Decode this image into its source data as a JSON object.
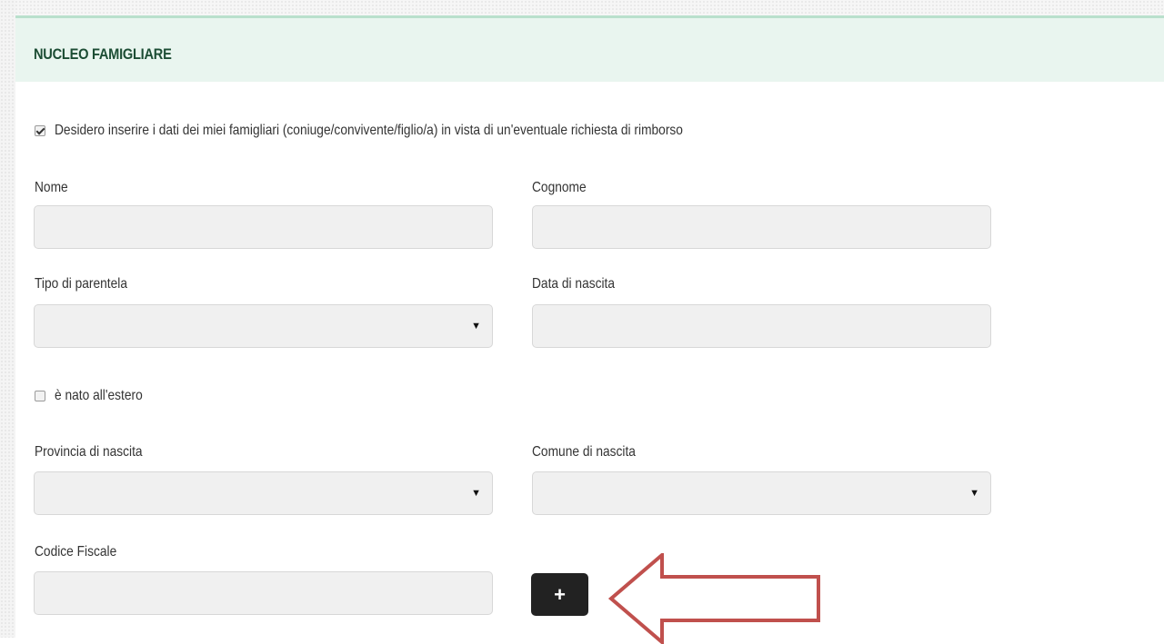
{
  "section": {
    "title": "NUCLEO FAMIGLIARE"
  },
  "consent": {
    "label": "Desidero inserire i dati dei miei famigliari (coniuge/convivente/figlio/a) in vista di un'eventuale richiesta di rimborso",
    "checked": true
  },
  "fields": {
    "nome": {
      "label": "Nome",
      "value": ""
    },
    "cognome": {
      "label": "Cognome",
      "value": ""
    },
    "tipo_parentela": {
      "label": "Tipo di parentela",
      "value": ""
    },
    "data_nascita": {
      "label": "Data di nascita",
      "value": ""
    },
    "provincia_nascita": {
      "label": "Provincia di nascita",
      "value": ""
    },
    "comune_nascita": {
      "label": "Comune di nascita",
      "value": ""
    },
    "codice_fiscale": {
      "label": "Codice Fiscale",
      "value": ""
    }
  },
  "born_abroad": {
    "label": "è nato all'estero",
    "checked": false
  },
  "add_button": {
    "symbol": "+"
  },
  "annotation": {
    "icon": "left-arrow-outline",
    "color": "#c0504d"
  },
  "colors": {
    "header_background": "#e9f5ef",
    "header_text": "#1c4d34",
    "button_background": "#222222"
  }
}
